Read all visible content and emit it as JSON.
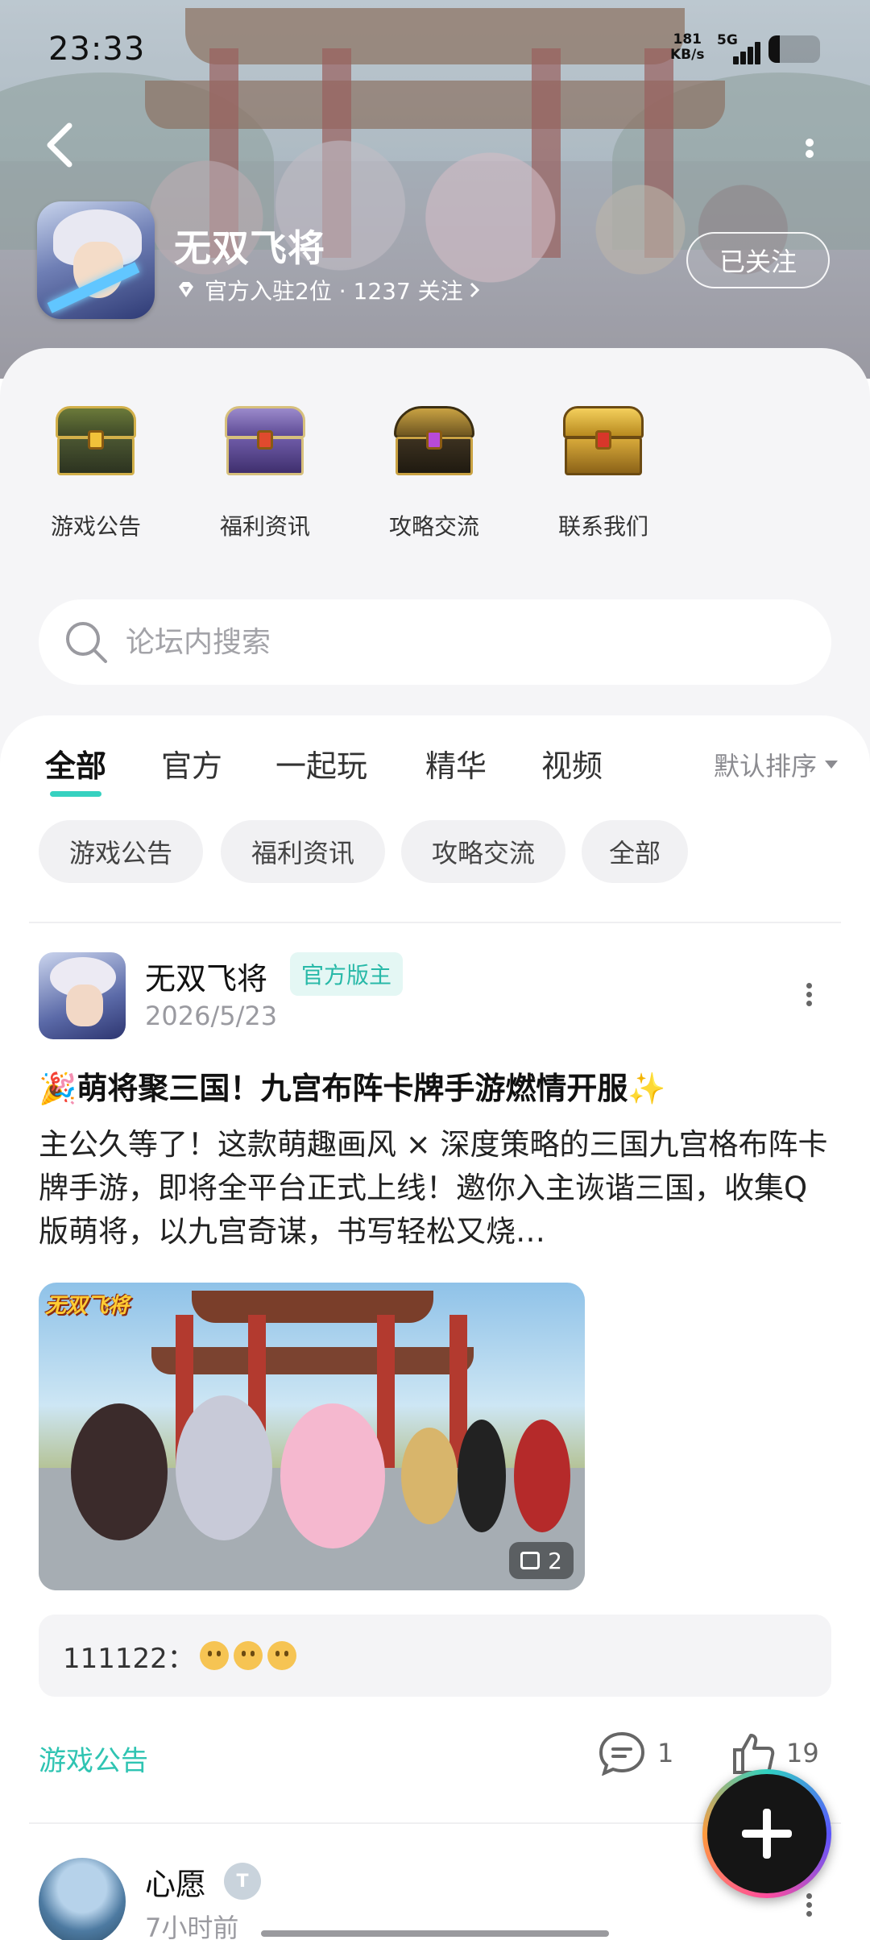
{
  "status_bar": {
    "time": "23:33",
    "speed_value": "181",
    "speed_unit": "KB/s",
    "network": "5G"
  },
  "header": {
    "game_name": "无双飞将",
    "meta_text": "官方入驻2位 · 1237 关注",
    "follow_label": "已关注",
    "icons": [
      "back-arrow-icon",
      "more-vertical-icon",
      "diamond-icon",
      "chevron-right-icon"
    ]
  },
  "categories": [
    {
      "label": "游戏公告",
      "icon": "green-gold-chest-icon"
    },
    {
      "label": "福利资讯",
      "icon": "purple-chest-icon"
    },
    {
      "label": "攻略交流",
      "icon": "dark-gold-chest-icon"
    },
    {
      "label": "联系我们",
      "icon": "gold-chest-icon"
    }
  ],
  "search": {
    "placeholder": "论坛内搜索"
  },
  "tabs": [
    {
      "label": "全部",
      "active": true
    },
    {
      "label": "官方"
    },
    {
      "label": "一起玩"
    },
    {
      "label": "精华"
    },
    {
      "label": "视频"
    }
  ],
  "sort_label": "默认排序",
  "chips": [
    "游戏公告",
    "福利资讯",
    "攻略交流",
    "全部"
  ],
  "post1": {
    "author": "无双飞将",
    "badge": "官方版主",
    "date": "2026/5/23",
    "title": "🎉萌将聚三国！九宫布阵卡牌手游燃情开服✨",
    "body": "主公久等了！这款萌趣画风 × 深度策略的三国九宫格布阵卡牌手游，即将全平台正式上线！邀你入主诙谐三国，收集Q版萌将，以九宫奇谋，书写轻松又烧…",
    "image_logo": "无双飞将",
    "image_count": "2",
    "comment_user": "111122：",
    "comment_emoji_count": 3,
    "tag": "游戏公告",
    "comments": "1",
    "likes": "19"
  },
  "post2": {
    "author": "心愿",
    "date": "7小时前"
  },
  "colors": {
    "accent": "#2fc4b2",
    "badge_bg": "#e4f7f4",
    "fab": "#151515"
  }
}
